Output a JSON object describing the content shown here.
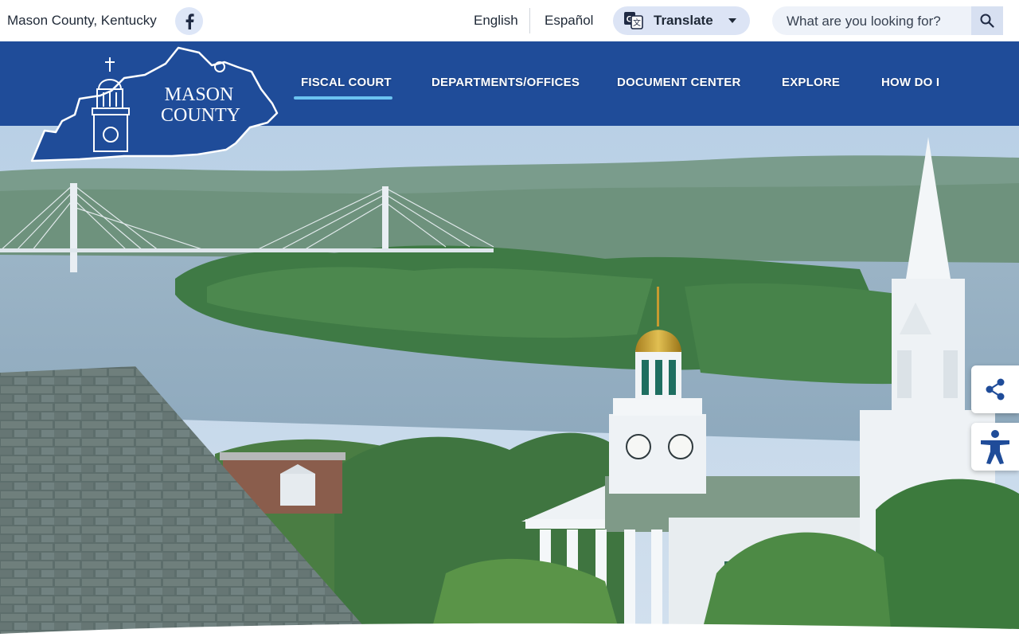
{
  "topbar": {
    "site_name": "Mason County, Kentucky",
    "languages": [
      "English",
      "Español"
    ],
    "translate_label": "Translate",
    "search_placeholder": "What are you looking for?"
  },
  "logo": {
    "line1": "MASON",
    "line2": "COUNTY"
  },
  "nav": {
    "items": [
      "FISCAL COURT",
      "DEPARTMENTS/OFFICES",
      "DOCUMENT CENTER",
      "EXPLORE",
      "HOW DO I"
    ],
    "active_index": 0
  },
  "icons": {
    "facebook": "facebook-icon",
    "translate": "google-translate-icon",
    "dropdown": "caret-down-icon",
    "search": "search-icon",
    "share": "share-icon",
    "accessibility": "accessibility-icon"
  },
  "colors": {
    "nav_bg": "#1f4c99",
    "active_underline": "#6cc3f0",
    "pill_bg": "#dce4f5"
  }
}
